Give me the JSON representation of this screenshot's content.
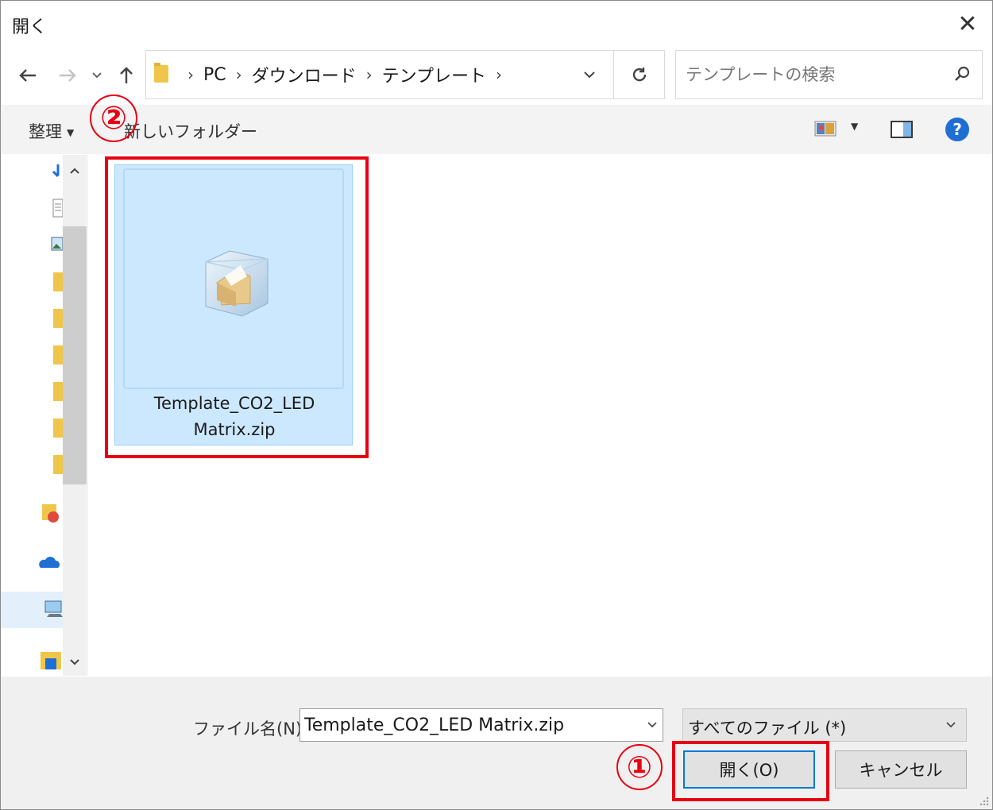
{
  "dialog": {
    "title": "開く",
    "close_symbol": "✕"
  },
  "navigation": {
    "back_icon": "arrow-left-icon",
    "forward_icon": "arrow-right-icon",
    "up_icon": "arrow-up-icon",
    "breadcrumbs": [
      "PC",
      "ダウンロード",
      "テンプレート"
    ],
    "search_placeholder": "テンプレートの検索"
  },
  "toolbar": {
    "organize_label": "整理",
    "new_folder_label": "新しいフォルダー"
  },
  "files": [
    {
      "name_line1": "Template_CO2_LED",
      "name_line2": "Matrix.zip",
      "icon": "zip-archive-icon",
      "selected": true
    }
  ],
  "footer": {
    "filename_label": "ファイル名(N):",
    "filename_value": "Template_CO2_LED Matrix.zip",
    "filetype_value": "すべてのファイル (*)",
    "open_label": "開く(O)",
    "cancel_label": "キャンセル"
  },
  "annotations": {
    "step1": "①",
    "step2": "②",
    "highlight_color": "#e60012"
  }
}
